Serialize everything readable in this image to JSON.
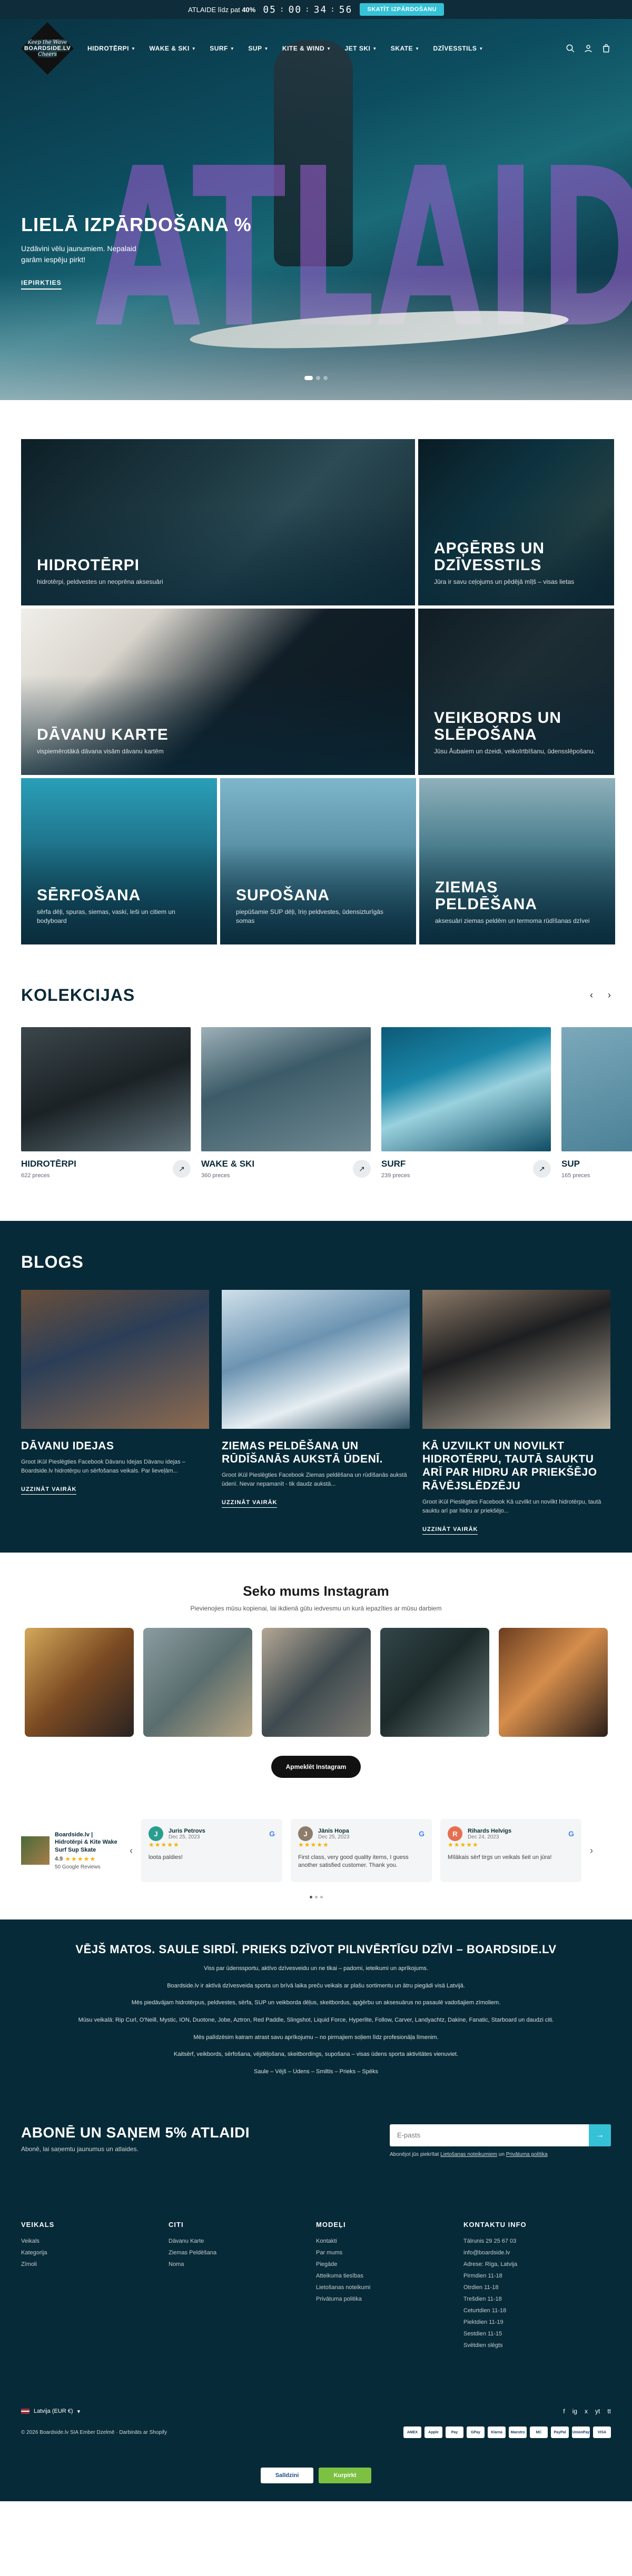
{
  "announcement": {
    "text_before": "ATLAIDE līdz pat",
    "discount": "40%",
    "countdown": [
      "05",
      "00",
      "34",
      "56"
    ],
    "cta": "SKATĪT IZPĀRDOŠANU"
  },
  "logo": {
    "line1": "Keep the Wave",
    "line2": "BOARDSIDE.LV",
    "line3": "Cheers"
  },
  "nav": {
    "items": [
      "HIDROTĒRPI",
      "WAKE & SKI",
      "SURF",
      "SUP",
      "KITE & WIND",
      "JET SKI",
      "SKATE",
      "DZĪVESSTILS"
    ]
  },
  "hero": {
    "bg_word": "ATLAIDES",
    "title": "LIELĀ IZPĀRDOŠANA %",
    "subtitle": "Uzdāvini vēlu jaunumiem. Nepalaid garām iespēju pirkt!",
    "cta": "IEPIRKTIES"
  },
  "categories": [
    {
      "title": "HIDROTĒRPI",
      "desc": "hidrotērpi, peldvestes un neoprēna aksesuāri"
    },
    {
      "title": "APĢĒRBS UN DZĪVESSTILS",
      "desc": "Jūra ir savu ceļojums un pēdējā mīļš – visas lietas"
    },
    {
      "title": "DĀVANU KARTE",
      "desc": "vispiemērotākā dāvana visām dāvanu kartēm"
    },
    {
      "title": "VEIKBORDS UN SLĒPOŠANA",
      "desc": "Jūsu Āubaiem un dzeidi, veikoīrtbīšanu, ūdensslēpošanu."
    },
    {
      "title": "SĒRFOŠANA",
      "desc": "sērfa dēļi, spuras, siemas, vaski, leši un citiem un bodyboard"
    },
    {
      "title": "SUPOŠANA",
      "desc": "piepūšamie SUP dēļi, īriņ peldvestes, ūdensizturīgās somas"
    },
    {
      "title": "ZIEMAS PELDĒŠANA",
      "desc": "aksesuāri ziemas peldēm un termoma rūdīšanas dzīvei"
    }
  ],
  "collections": {
    "title": "KOLEKCIJAS",
    "items": [
      {
        "name": "HIDROTĒRPI",
        "count": "622 preces"
      },
      {
        "name": "WAKE & SKI",
        "count": "360 preces"
      },
      {
        "name": "SURF",
        "count": "239 preces"
      },
      {
        "name": "SUP",
        "count": "165 preces"
      }
    ]
  },
  "blogs": {
    "title": "BLOGS",
    "items": [
      {
        "title": "DĀVANU IDEJAS",
        "excerpt": "Groot iKūl Pieslēgties Facebook Dāvanu Idejas Dāvanu idejas – Boardside.lv hidrotērpu un sērfošanas veikals. Par lieveļām...",
        "cta": "UZZINĀT VAIRĀK"
      },
      {
        "title": "ZIEMAS PELDĒŠANA UN RŪDĪŠANĀS AUKSTĀ ŪDENĪ.",
        "excerpt": "Groot iKūl Pieslēgties Facebook Ziemas peldēšana un rūdīšanās aukstā ūdenī. Nevar nepamanīt - tik daudz aukstā...",
        "cta": "UZZINĀT VAIRĀK"
      },
      {
        "title": "KĀ UZVILKT UN NOVILKT HIDROTĒRPU, TAUTĀ SAUKTU ARĪ PAR HIDRU AR PRIEKŠĒJO RĀVĒJSLĒDZĒJU",
        "excerpt": "Groot iKūl Pieslēgties Facebook Kā uzvilkt un novilkt hidrotērpu, tautā sauktu arī par hidru ar priekšējo...",
        "cta": "UZZINĀT VAIRĀK"
      }
    ]
  },
  "instagram": {
    "title": "Seko mums Instagram",
    "subtitle": "Pievienojies mūsu kopienai, lai ikdienā gūtu iedvesmu un kurā iepazīties ar mūsu darbiem",
    "cta": "Apmeklēt Instagram"
  },
  "reviews": {
    "summary": {
      "name": "Boardside.lv | Hidrotērpi & Kite Wake Surf Sup Skate",
      "rating": "4.9",
      "source": "50 Google Reviews"
    },
    "items": [
      {
        "initial": "J",
        "name": "Juris Petrovs",
        "date": "Dec 25, 2023",
        "text": "loota paldies!",
        "color": "#2a9d8f"
      },
      {
        "initial": "J",
        "name": "Jānis Hopa",
        "date": "Dec 25, 2023",
        "text": "First class, very good quality items, I guess another satisfied customer. Thank you.",
        "color": "#8e7c6a"
      },
      {
        "initial": "R",
        "name": "Rihards Helvigs",
        "date": "Dec 24, 2023",
        "text": "Mīlākais sērf tirgs un veikals šeit un jūra!",
        "color": "#e76f51"
      }
    ]
  },
  "footer": {
    "seo_title": "VĒJŠ MATOS. SAULE SIRDĪ. PRIEKS DZĪVOT PILNVĒRTĪGU DZĪVI – BOARDSIDE.LV",
    "seo_paragraphs": [
      "Viss par ūdenssportu, aktīvo dzīvesveidu un ne tikai – padomi, ieteikumi un aprīkojums.",
      "Boardside.lv ir aktīvā dzīvesveida sporta un brīvā laika preču veikals ar plašu sortimentu un ātru piegādi visā Latvijā.",
      "Mēs piedāvājam hidrotērpus, peldvestes, sērfa, SUP un veikborda dēļus, skeitbordus, apģērbu un aksesuārus no pasaulē vadošajiem zīmoliem.",
      "Mūsu veikalā: Rip Curl, O'Neill, Mystic, ION, Duotone, Jobe, Aztron, Red Paddle, Slingshot, Liquid Force, Hyperlite, Follow, Carver, Landyachtz, Dakine, Fanatic, Starboard un daudzi citi.",
      "Mēs palīdzēsim katram atrast savu aprīkojumu – no pirmajiem soļiem līdz profesionāļa līmenim.",
      "Kaitsērf, veikbords, sērfošana, vējdēļošana, skeitbordings, supošana – visas ūdens sporta aktivitātes vienuviet.",
      "Saule – Vējš – Ūdens – Smiltis – Prieks – Spēks"
    ],
    "newsletter": {
      "title": "ABONĒ UN SAŅEM 5% ATLAIDI",
      "sub": "Abonē, lai saņemtu jaunumus un atlaides.",
      "placeholder": "E-pasts",
      "legal_prefix": "Abonējot jūs piekrītat",
      "legal_link1": "Lietošanas noteikumiem",
      "legal_and": "un",
      "legal_link2": "Privātuma politika"
    },
    "columns": [
      {
        "title": "VEIKALS",
        "links": [
          "Veikals",
          "Kategorija",
          "Zīmoli"
        ]
      },
      {
        "title": "CITI",
        "links": [
          "Dāvanu Karte",
          "Ziemas Peldēšana",
          "Noma"
        ]
      },
      {
        "title": "MODEĻI",
        "links": [
          "Kontakti",
          "Par mums",
          "Piegāde",
          "Atteikuma tiesības",
          "Lietošanas noteikumi",
          "Privātuma politika"
        ]
      },
      {
        "title": "KONTAKTU INFO",
        "links": [
          "Tālrunis 29 25 67 03",
          "info@boardside.lv",
          "Adrese: Rīga, Latvija",
          "Pirmdien 11-18",
          "Otrdien 11-18",
          "Trešdien 11-18",
          "Ceturtdien 11-18",
          "Piektdien 11-19",
          "Sestdien 11-15",
          "Svētdien slēgts"
        ]
      }
    ],
    "locale": "Latvija (EUR €)",
    "copyright": "© 2026 Boardside.lv SIA Ember Dzelmē · Darbināts ar Shopify",
    "payments": [
      "AMEX",
      "Apple",
      "Pay",
      "GPay",
      "Klarna",
      "Maestro",
      "MC",
      "PayPal",
      "UnionPay",
      "VISA"
    ],
    "badges": [
      "Salīdzini",
      "Kurpirkt"
    ],
    "social": [
      "f",
      "ig",
      "x",
      "yt",
      "tt"
    ]
  }
}
